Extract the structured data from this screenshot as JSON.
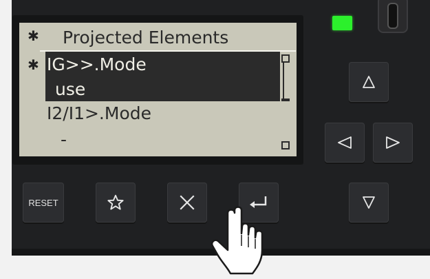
{
  "lcd": {
    "title": "Projected Elements",
    "rows": [
      {
        "text": "IG>>.Mode"
      },
      {
        "text": "use"
      },
      {
        "text": "I2/I1>.Mode"
      },
      {
        "text": "-"
      }
    ],
    "star_glyph": "✱"
  },
  "keys": {
    "reset_label": "RESET",
    "star_icon": "star-icon",
    "close_icon": "close-icon",
    "enter_icon": "enter-icon",
    "up_icon": "triangle-up-icon",
    "left_icon": "triangle-left-icon",
    "right_icon": "triangle-right-icon",
    "down_icon": "triangle-down-icon"
  },
  "status": {
    "led_color": "#2cf02c"
  },
  "colors": {
    "device_body": "#1f2022",
    "lcd_background": "#c9c8b9",
    "lcd_highlight": "#2b2b2b",
    "key_face": "#2c2d30"
  }
}
